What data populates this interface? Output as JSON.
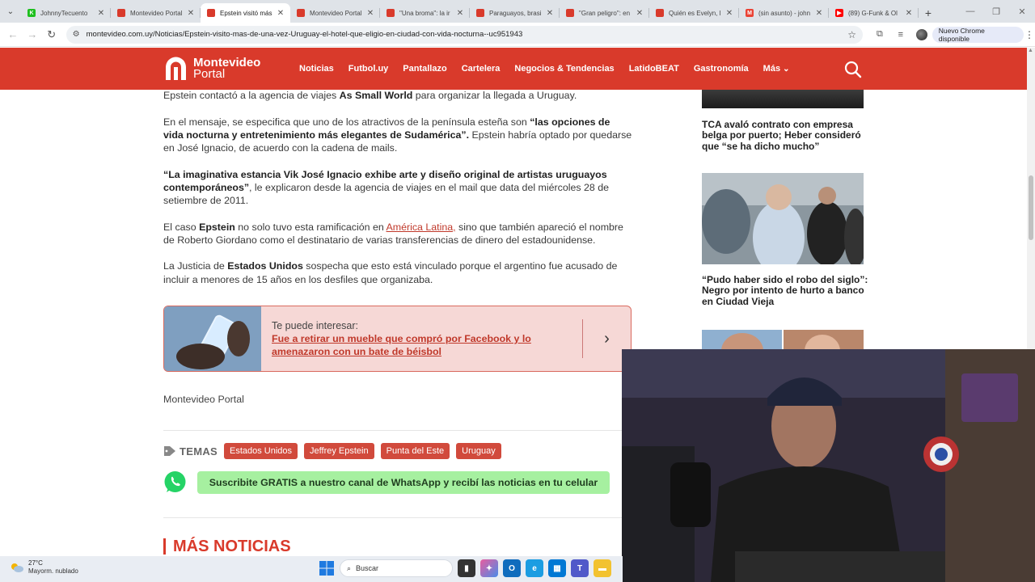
{
  "browser": {
    "tabs": [
      {
        "title": "JohnnyTecuento",
        "favicon_color": "#1fbf1f",
        "favicon_letter": "K",
        "active": false
      },
      {
        "title": "Montevideo Portal",
        "favicon_color": "#d93a2b",
        "favicon_letter": "",
        "active": false
      },
      {
        "title": "Epstein visitó más",
        "favicon_color": "#d93a2b",
        "favicon_letter": "",
        "active": true
      },
      {
        "title": "Montevideo Portal",
        "favicon_color": "#d93a2b",
        "favicon_letter": "",
        "active": false
      },
      {
        "title": "\"Una broma\": la ir",
        "favicon_color": "#d93a2b",
        "favicon_letter": "",
        "active": false
      },
      {
        "title": "Paraguayos, brasi",
        "favicon_color": "#d93a2b",
        "favicon_letter": "",
        "active": false
      },
      {
        "title": "\"Gran peligro\": en",
        "favicon_color": "#d93a2b",
        "favicon_letter": "",
        "active": false
      },
      {
        "title": "Quién es Evelyn, l",
        "favicon_color": "#d93a2b",
        "favicon_letter": "",
        "active": false
      },
      {
        "title": "(sin asunto) - john",
        "favicon_color": "#ea4335",
        "favicon_letter": "M",
        "active": false
      },
      {
        "title": "(89) G-Funk & Ol",
        "favicon_color": "#ff0000",
        "favicon_letter": "▶",
        "active": false
      }
    ],
    "url": "montevideo.com.uy/Noticias/Epstein-visito-mas-de-una-vez-Uruguay-el-hotel-que-eligio-en-ciudad-con-vida-nocturna--uc951943",
    "update_label": "Nuevo Chrome disponible"
  },
  "site": {
    "logo_line1": "Montevideo",
    "logo_line2": "Portal",
    "brand_color": "#d93a2b",
    "nav": [
      "Noticias",
      "Futbol.uy",
      "Pantallazo",
      "Cartelera",
      "Negocios & Tendencias",
      "LatidoBEAT",
      "Gastronomía"
    ],
    "nav_more": "Más"
  },
  "article": {
    "p1": {
      "a": "Epstein contactó a la agencia de viajes ",
      "b": "As Small World",
      "c": " para organizar la llegada a Uruguay."
    },
    "p2": {
      "a": "En el mensaje, se especifica que uno de los atractivos de la península esteña son ",
      "b": "“las opciones de vida nocturna y entretenimiento más elegantes de Sudamérica”.",
      "c": " Epstein habría optado por quedarse en José Ignacio, de acuerdo con la cadena de mails."
    },
    "p3": {
      "b": "“La imaginativa estancia Vik José Ignacio exhibe arte y diseño original de artistas uruguayos contemporáneos”",
      "c": ", le explicaron desde la agencia de viajes en el mail que data del miércoles 28 de setiembre de 2011."
    },
    "p4": {
      "a": "El caso ",
      "b": "Epstein",
      "c": " no solo tuvo esta ramificación en ",
      "link": "América Latina,",
      "d": " sino que también apareció el nombre de Roberto Giordano como el destinatario de varias transferencias de dinero del estadounidense."
    },
    "p5": {
      "a": "La Justicia de ",
      "b": "Estados Unidos",
      "c": " sospecha que esto está vinculado porque el argentino fue acusado de incluir a menores de 15 años en los desfiles que organizaba."
    },
    "related": {
      "kicker": "Te puede interesar:",
      "title": "Fue a retirar un mueble que compró por Facebook y lo amenazaron con un bate de béisbol"
    },
    "byline": "Montevideo Portal",
    "temas_label": "TEMAS",
    "tags": [
      "Estados Unidos",
      "Jeffrey Epstein",
      "Punta del Este",
      "Uruguay"
    ],
    "whatsapp_cta": "Suscribite GRATIS a nuestro canal de WhatsApp y recibí las noticias en tu celular",
    "more_news": "MÁS NOTICIAS"
  },
  "sidebar": {
    "headline1": "TCA avaló contrato con empresa belga por puerto; Heber consideró que “se ha dicho mucho”",
    "headline2": "“Pudo haber sido el robo del siglo”: Negro por intento de hurto a banco en Ciudad Vieja"
  },
  "taskbar": {
    "temp": "27°C",
    "weather": "Mayorm. nublado",
    "search_placeholder": "Buscar"
  }
}
